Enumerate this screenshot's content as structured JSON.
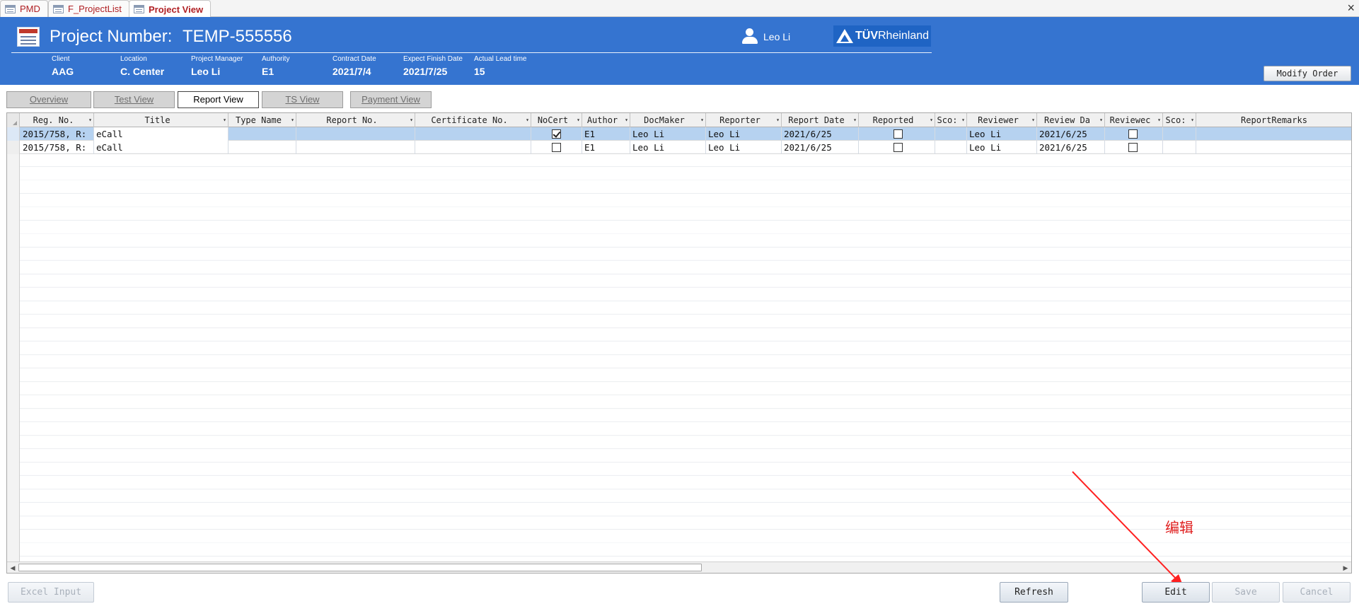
{
  "doc_tabs": [
    {
      "label": "PMD",
      "active": false
    },
    {
      "label": "F_ProjectList",
      "active": false
    },
    {
      "label": "Project View",
      "active": true
    }
  ],
  "window_close": "×",
  "header": {
    "project_label": "Project Number:",
    "project_number": "TEMP-555556",
    "user_name": "Leo Li",
    "logo_bold": "TÜV",
    "logo_rest": "Rheinland",
    "fields": [
      {
        "label": "Client",
        "value": "AAG"
      },
      {
        "label": "Location",
        "value": "C. Center"
      },
      {
        "label": "Project Manager",
        "value": "Leo Li"
      },
      {
        "label": "Authority",
        "value": "E1"
      },
      {
        "label": "Contract Date",
        "value": "2021/7/4"
      },
      {
        "label": "Expect Finish Date",
        "value": "2021/7/25"
      },
      {
        "label": "Actual Lead time",
        "value": "15"
      }
    ],
    "modify_button": "Modify Order"
  },
  "view_tabs": [
    {
      "label": "Overview",
      "active": false
    },
    {
      "label": "Test View",
      "active": false
    },
    {
      "label": "Report View",
      "active": true
    },
    {
      "label": "TS View",
      "active": false
    },
    {
      "label": "Payment View",
      "active": false
    }
  ],
  "table": {
    "columns": [
      "Reg. No.",
      "Title",
      "Type Name",
      "Report No.",
      "Certificate No.",
      "NoCert",
      "Author",
      "DocMaker",
      "Reporter",
      "Report Date",
      "Reported",
      "Sco:",
      "Reviewer",
      "Review Da",
      "Reviewec",
      "Sco:",
      "ReportRemarks"
    ],
    "rows": [
      {
        "selected": true,
        "reg_no": "2015/758, R:",
        "title": "eCall",
        "type_name": "",
        "report_no": "",
        "certificate_no": "",
        "nocert": true,
        "author": "E1",
        "docmaker": "Leo Li",
        "reporter": "Leo Li",
        "report_date": "2021/6/25",
        "reported": false,
        "score1": "",
        "reviewer": "Leo Li",
        "review_date": "2021/6/25",
        "reviewed": false,
        "score2": "",
        "remarks": ""
      },
      {
        "selected": false,
        "reg_no": "2015/758, R:",
        "title": "eCall",
        "type_name": "",
        "report_no": "",
        "certificate_no": "",
        "nocert": false,
        "author": "E1",
        "docmaker": "Leo Li",
        "reporter": "Leo Li",
        "report_date": "2021/6/25",
        "reported": false,
        "score1": "",
        "reviewer": "Leo Li",
        "review_date": "2021/6/25",
        "reviewed": false,
        "score2": "",
        "remarks": ""
      }
    ]
  },
  "annotation": {
    "label": "编辑",
    "color": "#e02020"
  },
  "buttons": {
    "excel_input": "Excel Input",
    "refresh": "Refresh",
    "edit": "Edit",
    "save": "Save",
    "cancel": "Cancel"
  },
  "colors": {
    "header_blue": "#3574d0",
    "tab_text": "#b02024",
    "selection": "#b6d2f0"
  }
}
